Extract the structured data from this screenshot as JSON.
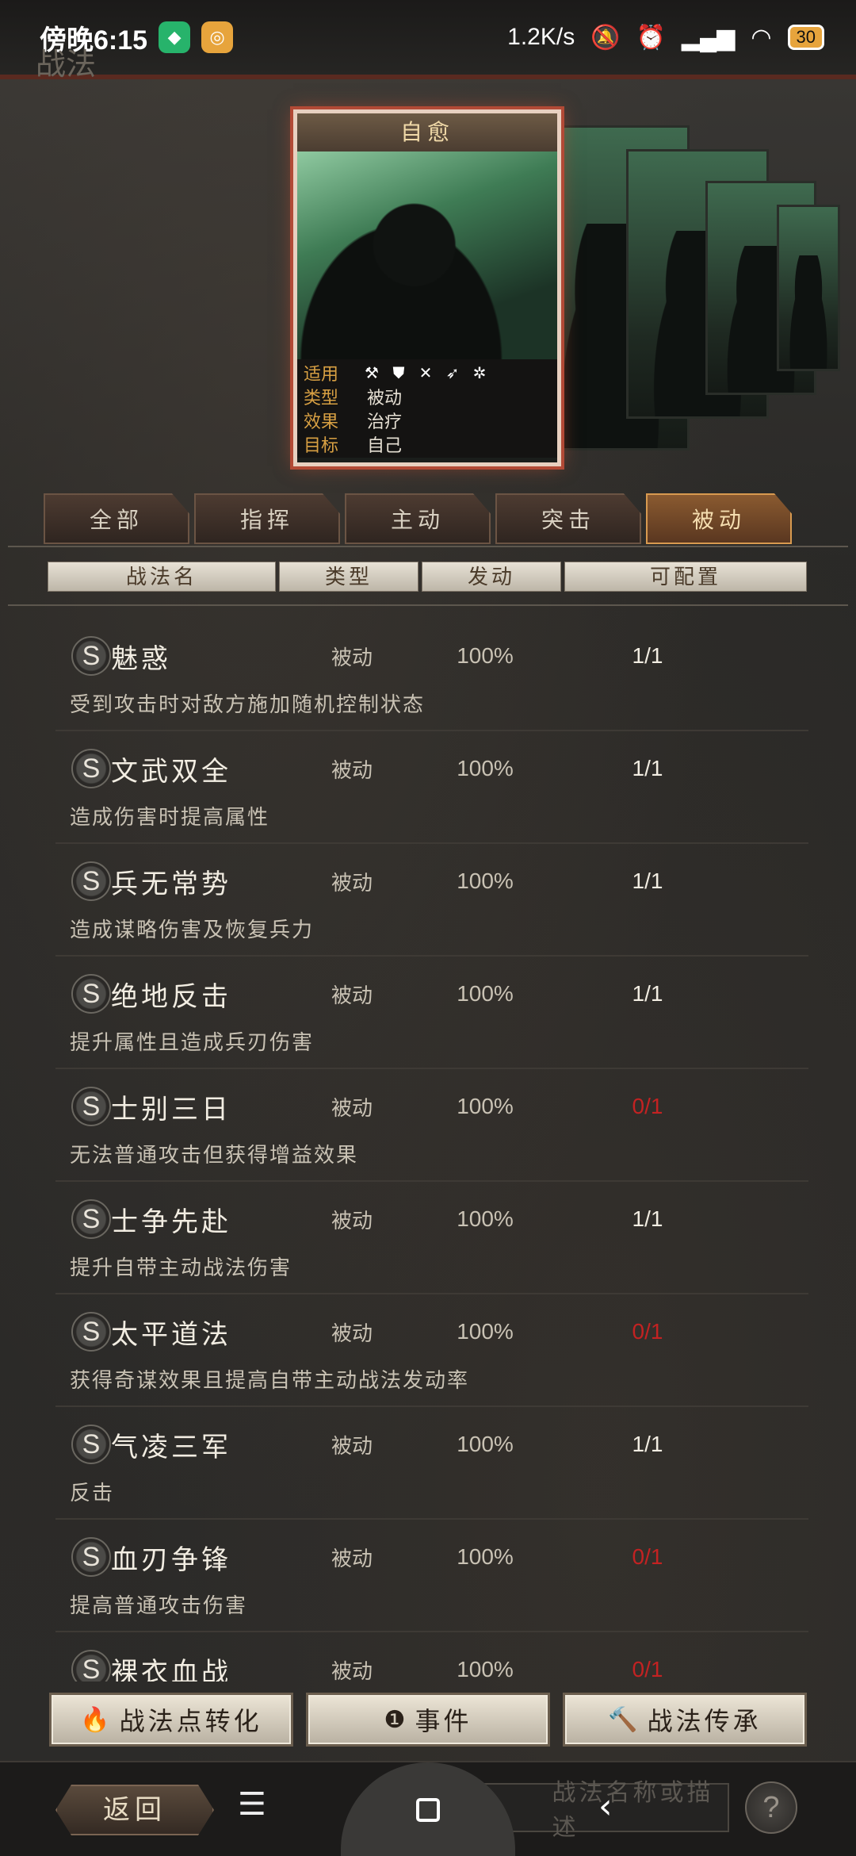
{
  "status_bar": {
    "time": "傍晚6:15",
    "speed": "1.2K/s",
    "battery": "30",
    "page_title_behind": "战法"
  },
  "card": {
    "title": "自愈",
    "rows": [
      {
        "key": "适用",
        "icons": [
          "axe-icon",
          "shield-icon",
          "crossbow-icon",
          "spear-icon",
          "wheel-icon"
        ]
      },
      {
        "key": "类型",
        "value": "被动"
      },
      {
        "key": "效果",
        "value": "治疗"
      },
      {
        "key": "目标",
        "value": "自己"
      }
    ]
  },
  "tabs": [
    "全部",
    "指挥",
    "主动",
    "突击",
    "被动"
  ],
  "active_tab": "被动",
  "columns": [
    "战法名",
    "类型",
    "发动",
    "可配置"
  ],
  "rows": [
    {
      "grade": "S",
      "name": "魅惑",
      "type": "被动",
      "rate": "100%",
      "config": "1/1",
      "desc": "受到攻击时对敌方施加随机控制状态",
      "full": true
    },
    {
      "grade": "S",
      "name": "文武双全",
      "type": "被动",
      "rate": "100%",
      "config": "1/1",
      "desc": "造成伤害时提高属性",
      "full": true
    },
    {
      "grade": "S",
      "name": "兵无常势",
      "type": "被动",
      "rate": "100%",
      "config": "1/1",
      "desc": "造成谋略伤害及恢复兵力",
      "full": true
    },
    {
      "grade": "S",
      "name": "绝地反击",
      "type": "被动",
      "rate": "100%",
      "config": "1/1",
      "desc": "提升属性且造成兵刃伤害",
      "full": true
    },
    {
      "grade": "S",
      "name": "士别三日",
      "type": "被动",
      "rate": "100%",
      "config": "0/1",
      "desc": "无法普通攻击但获得增益效果",
      "full": false
    },
    {
      "grade": "S",
      "name": "士争先赴",
      "type": "被动",
      "rate": "100%",
      "config": "1/1",
      "desc": "提升自带主动战法伤害",
      "full": true
    },
    {
      "grade": "S",
      "name": "太平道法",
      "type": "被动",
      "rate": "100%",
      "config": "0/1",
      "desc": "获得奇谋效果且提高自带主动战法发动率",
      "full": false
    },
    {
      "grade": "S",
      "name": "气凌三军",
      "type": "被动",
      "rate": "100%",
      "config": "1/1",
      "desc": "反击",
      "full": true
    },
    {
      "grade": "S",
      "name": "血刃争锋",
      "type": "被动",
      "rate": "100%",
      "config": "0/1",
      "desc": "提高普通攻击伤害",
      "full": false
    },
    {
      "grade": "S",
      "name": "裸衣血战",
      "type": "被动",
      "rate": "100%",
      "config": "0/1",
      "desc": "",
      "full": false
    }
  ],
  "actions": [
    {
      "icon": "flame-icon",
      "glyph": "🔥",
      "label": "战法点转化"
    },
    {
      "icon": "event-icon",
      "glyph": "❶",
      "label": "事件"
    },
    {
      "icon": "hammer-icon",
      "glyph": "🔨",
      "label": "战法传承"
    }
  ],
  "bottom": {
    "back": "返回",
    "search_placeholder": "战法名称或描述",
    "help": "?"
  }
}
